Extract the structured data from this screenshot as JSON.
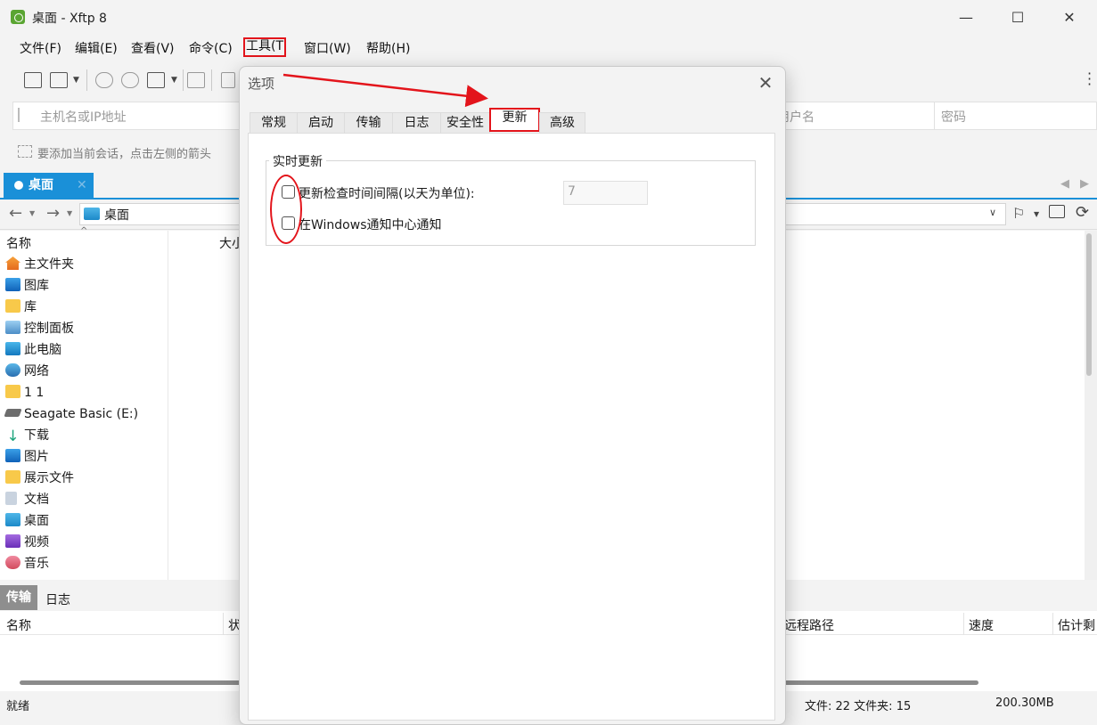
{
  "window": {
    "title": "桌面 - Xftp 8",
    "minimize": "—",
    "maximize": "☐",
    "close": "✕"
  },
  "menu": [
    "文件(F)",
    "编辑(E)",
    "查看(V)",
    "命令(C)",
    "工具(T",
    "窗口(W)",
    "帮助(H)"
  ],
  "address": {
    "host_placeholder": "主机名或IP地址",
    "user_placeholder": "用户名",
    "password_placeholder": "密码",
    "hint": "要添加当前会话，点击左侧的箭头"
  },
  "tab": {
    "label": "桌面",
    "close": "✕"
  },
  "path": {
    "current": "桌面"
  },
  "filelist": {
    "columns": [
      "名称",
      "大小"
    ],
    "items": [
      {
        "name": "主文件夹",
        "icon": "home-icon"
      },
      {
        "name": "图库",
        "icon": "gallery-icon"
      },
      {
        "name": "库",
        "icon": "folder-icon"
      },
      {
        "name": "控制面板",
        "icon": "control-panel-icon"
      },
      {
        "name": "此电脑",
        "icon": "computer-icon"
      },
      {
        "name": "网络",
        "icon": "network-icon"
      },
      {
        "name": "1 1",
        "icon": "folder-icon"
      },
      {
        "name": "Seagate Basic (E:)",
        "icon": "drive-icon"
      },
      {
        "name": "下载",
        "icon": "download-icon"
      },
      {
        "name": "图片",
        "icon": "picture-icon"
      },
      {
        "name": "展示文件",
        "icon": "folder-icon"
      },
      {
        "name": "文档",
        "icon": "document-icon"
      },
      {
        "name": "桌面",
        "icon": "desktop-icon"
      },
      {
        "name": "视频",
        "icon": "video-icon"
      },
      {
        "name": "音乐",
        "icon": "music-icon"
      }
    ]
  },
  "transfer": {
    "tabs": [
      "传输",
      "日志"
    ],
    "columns": [
      "名称",
      "状",
      "远程路径",
      "速度",
      "估计剩"
    ]
  },
  "status": {
    "left": "就绪",
    "files": "文件: 22  文件夹: 15",
    "size": "200.30MB"
  },
  "dialog": {
    "title": "选项",
    "close": "✕",
    "tabs": [
      "常规",
      "启动",
      "传输",
      "日志",
      "安全性",
      "更新",
      "高级"
    ],
    "group_title": "实时更新",
    "check_interval_label": "更新检查时间间隔(以天为单位):",
    "check_interval_value": "7",
    "notify_label": "在Windows通知中心通知"
  },
  "colors": {
    "accent": "#1a90d8",
    "annotation": "#e3141b"
  }
}
